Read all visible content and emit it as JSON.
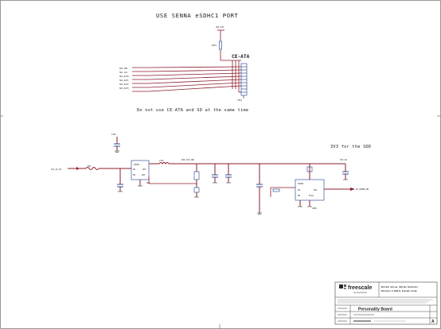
{
  "title": "USE SENNA eSDHC1 PORT",
  "connector_label": "CE-ATA",
  "note_cf": "Do not use CE-ATA and SD at the same time",
  "note_3v3": "3V3 for the SDD",
  "title_block": {
    "company_logo_text": "freescale",
    "company_logo_sub": "semiconductor",
    "company_line1": "Rollins Set-up (Online Solution)",
    "company_line2": "Wireless & Mobile Systems Group",
    "board_name": "Personality Board",
    "rev": "A"
  },
  "colors": {
    "wire": "#8c1c2b",
    "part": "#1d3a8a",
    "frame": "#555555"
  }
}
